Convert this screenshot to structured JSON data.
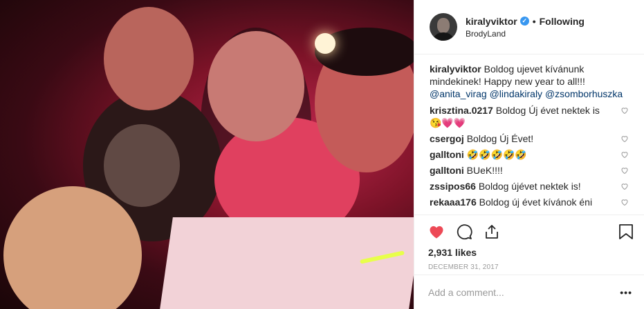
{
  "header": {
    "username": "kiralyviktor",
    "verified_icon": "verified-badge-icon",
    "separator": "•",
    "follow_label": "Following",
    "location": "BrodyLand"
  },
  "caption": {
    "username": "kiralyviktor",
    "text": "Boldog ujevet kívánunk mindekinek! Happy new year to all!!!",
    "mentions": [
      "@anita_virag",
      "@lindakiraly",
      "@zsomborhuszka"
    ]
  },
  "comments": [
    {
      "username": "krisztina.0217",
      "text": "Boldog Új évet nektek is 😘💗💗"
    },
    {
      "username": "csergoj",
      "text": "Boldog Új Évet!"
    },
    {
      "username": "galltoni",
      "text": "🤣🤣🤣🤣🤣"
    },
    {
      "username": "galltoni",
      "text": "BUeK!!!!"
    },
    {
      "username": "zssipos66",
      "text": "Boldog újévet nektek is!"
    },
    {
      "username": "rekaaa176",
      "text": "Boldog új évet kívánok éni"
    }
  ],
  "actions": {
    "like_icon": "heart-filled-icon",
    "comment_icon": "comment-icon",
    "share_icon": "share-icon",
    "save_icon": "bookmark-icon",
    "like_color": "#ed4956"
  },
  "likes": "2,931 likes",
  "date": "DECEMBER 31, 2017",
  "add_comment": {
    "placeholder": "Add a comment...",
    "more_label": "•••"
  }
}
